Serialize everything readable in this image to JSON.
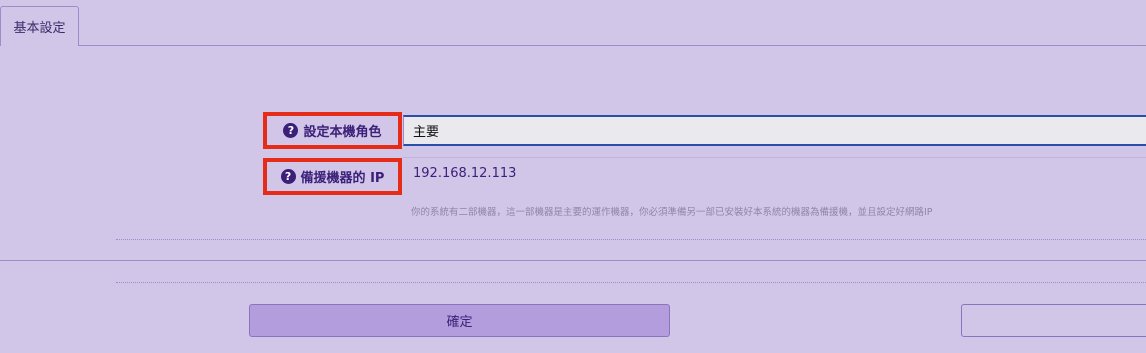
{
  "tabs": [
    {
      "label": "基本設定",
      "active": true
    }
  ],
  "form": {
    "role": {
      "label": "設定本機角色",
      "icon": "question-circle-icon",
      "value": "主要"
    },
    "backup_ip": {
      "label": "備援機器的 IP",
      "icon": "question-circle-icon",
      "value": "192.168.12.113"
    },
    "hint": "你的系統有二部機器，這一部機器是主要的運作機器，你必須準備另一部已安裝好本系統的機器為備援機，並且設定好網路IP"
  },
  "buttons": {
    "confirm": "確定",
    "second": ""
  },
  "colors": {
    "background": "#d2c6e8",
    "highlight_border": "#e52c18",
    "primary_button": "#b39ddd",
    "text": "#3b1f78"
  }
}
